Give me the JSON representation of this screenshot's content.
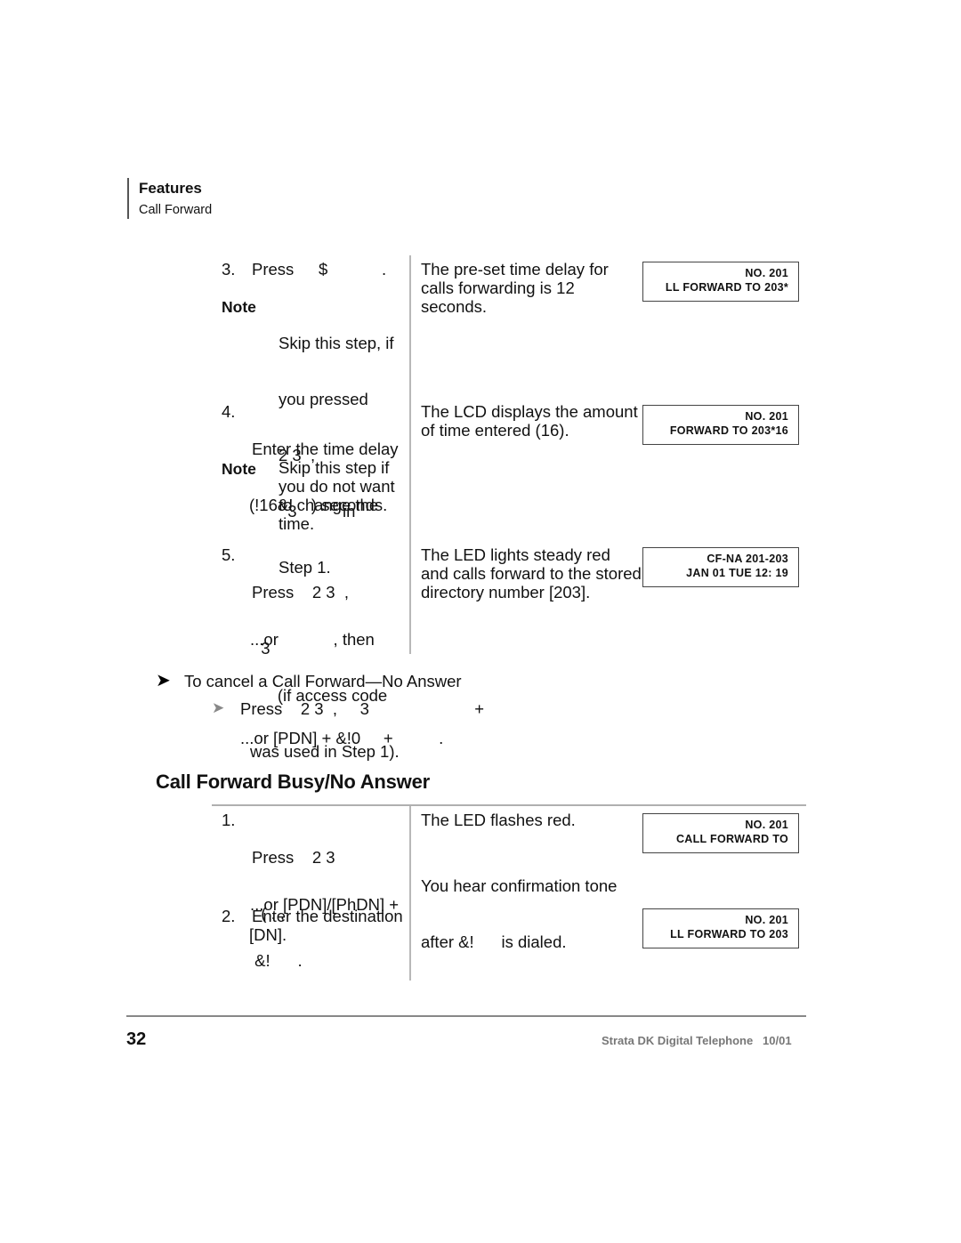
{
  "header": {
    "section": "Features",
    "subsection": "Call Forward"
  },
  "table1": {
    "step3": {
      "num": "3.",
      "text": "Press",
      "key": "$",
      "period": ".",
      "note_label": "Note",
      "note_lines": [
        "Skip this step, if",
        "you pressed",
        "2 3  ,",
        "  3          in",
        "Step 1."
      ],
      "result": [
        "The pre-set time delay for",
        "calls forwarding is 12",
        "seconds."
      ],
      "lcd": [
        "NO.  201",
        "LL  FORWARD  TO 203*"
      ]
    },
    "step4": {
      "num": "4.",
      "lines": [
        "Enter the time delay",
        "(!16&!    ) seconds."
      ],
      "note_label": "Note",
      "note_lines": [
        "Skip this step if",
        "you do not want",
        "to change the",
        "time."
      ],
      "result": [
        "The LCD displays the amount",
        "of time entered (16)."
      ],
      "lcd": [
        "NO.  201",
        "FORWARD  TO 203*16"
      ]
    },
    "step5": {
      "num": "5.",
      "lines": [
        "Press    2 3  ,",
        "  3"
      ],
      "alt_lines": [
        "...or            , then",
        "      (if access code",
        "was used in Step 1)."
      ],
      "result": [
        "The LED lights steady red",
        "and calls forward to the stored",
        "directory number [203]."
      ],
      "lcd": [
        "CF-NA  201-203",
        "JAN  01  TUE  12: 19"
      ]
    }
  },
  "cancel": {
    "heading": "To cancel a Call Forward—No Answer",
    "press_line": "Press    2 3  ,     3                       +",
    "or_line": "...or [PDN] + &!0     +          ."
  },
  "section2": {
    "title": "Call Forward  Busy/No Answer",
    "step1": {
      "num": "1.",
      "lines": [
        "Press    2 3",
        "  ( . ,"
      ],
      "alt_lines": [
        "...or [PDN]/[PhDN] +",
        " &!      ."
      ],
      "result1": "The LED flashes red.",
      "result2": [
        "You hear confirmation tone",
        "after &!      is dialed."
      ],
      "lcd": [
        "NO.  201",
        "CALL  FORWARD  TO"
      ]
    },
    "step2": {
      "num": "2.",
      "lines": [
        "Enter the destination",
        "[DN]."
      ],
      "lcd": [
        "NO.  201",
        "LL  FORWARD  TO 203"
      ]
    }
  },
  "footer": {
    "page_number": "32",
    "doc_title": "Strata DK Digital Telephone   10/01"
  },
  "icons": {
    "arrow_black": "➤",
    "arrow_grey": "➤"
  }
}
